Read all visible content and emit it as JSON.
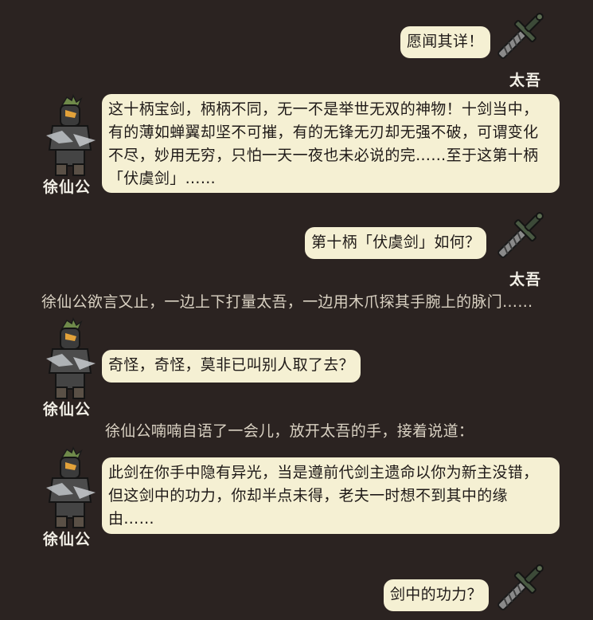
{
  "characters": {
    "taiwu": {
      "name": "太吾",
      "portrait_icon": "sword-icon"
    },
    "xu": {
      "name": "徐仙公",
      "portrait_icon": "armored-figure-icon"
    }
  },
  "dialogue": [
    {
      "speaker": "taiwu",
      "text": "愿闻其详！"
    },
    {
      "speaker": "xu",
      "text": "这十柄宝剑，柄柄不同，无一不是举世无双的神物！十剑当中，\n有的薄如蝉翼却坚不可摧，有的无锋无刃却无强不破，可谓变化\n不尽，妙用无穷，只怕一天一夜也未必说的完……至于这第十柄\n「伏虞剑」……"
    },
    {
      "speaker": "taiwu",
      "text": "第十柄「伏虞剑」如何？"
    },
    {
      "narration": "徐仙公欲言又止，一边上下打量太吾，一边用木爪探其手腕上的脉门……"
    },
    {
      "speaker": "xu",
      "text": "奇怪，奇怪，莫非已叫别人取了去？"
    },
    {
      "narration": "徐仙公喃喃自语了一会儿，放开太吾的手，接着说道："
    },
    {
      "speaker": "xu",
      "text": "此剑在你手中隐有异光，当是遵前代剑主遗命以你为新主没错，\n但这剑中的功力，你却半点未得，老夫一时想不到其中的缘\n由……"
    },
    {
      "speaker": "taiwu",
      "text": "剑中的功力？"
    }
  ],
  "colors": {
    "background": "#2b2321",
    "bubble": "#f5f0d3",
    "bubble_text": "#1f1a18",
    "name_text": "#f2efe6",
    "narration_text": "#d9d1c2"
  }
}
